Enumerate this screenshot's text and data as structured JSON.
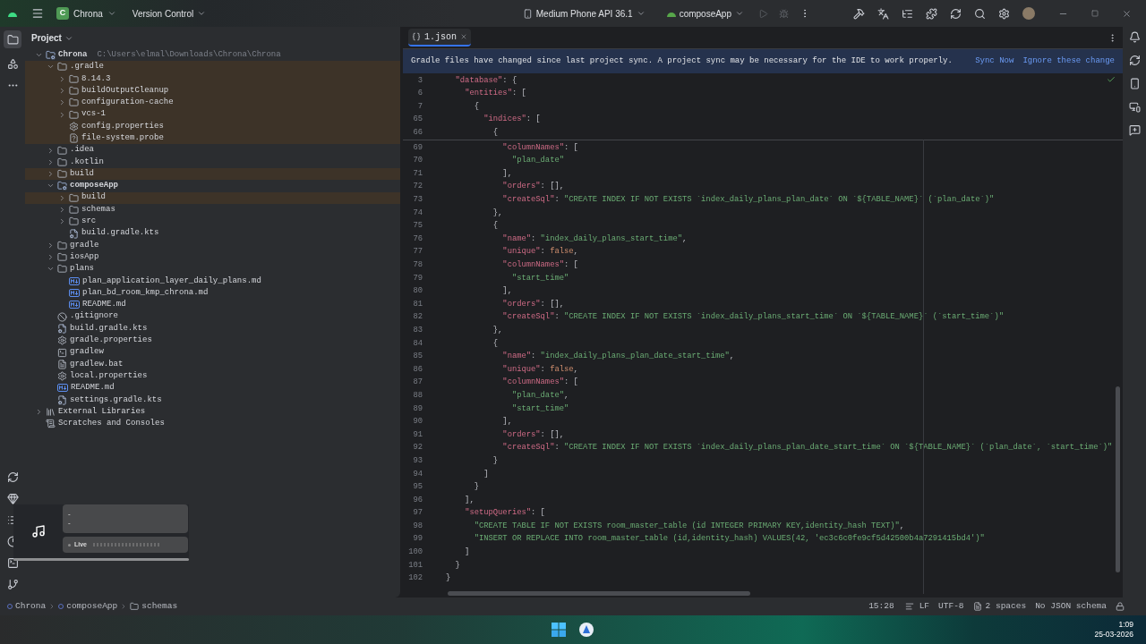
{
  "title_bar": {
    "project_badge": "C",
    "project": "Chrona",
    "vcs": "Version Control",
    "device": "Medium Phone API 36.1",
    "run_config": "composeApp"
  },
  "project_panel": {
    "title": "Project",
    "tree": [
      {
        "label": "Chrona",
        "hint": "C:\\Users\\elmal\\Downloads\\Chrona\\Chrona",
        "kind": "module",
        "expanded": true,
        "excluded": false,
        "children": [
          {
            "label": ".gradle",
            "kind": "folder",
            "expanded": true,
            "excluded": true,
            "children": [
              {
                "label": "8.14.3",
                "kind": "folder",
                "expanded": false,
                "excluded": true
              },
              {
                "label": "buildOutputCleanup",
                "kind": "folder",
                "expanded": false,
                "excluded": true
              },
              {
                "label": "configuration-cache",
                "kind": "folder",
                "expanded": false,
                "excluded": true
              },
              {
                "label": "vcs-1",
                "kind": "folder",
                "expanded": false,
                "excluded": true
              },
              {
                "label": "config.properties",
                "kind": "settings",
                "excluded": true
              },
              {
                "label": "file-system.probe",
                "kind": "unknown",
                "excluded": true
              }
            ]
          },
          {
            "label": ".idea",
            "kind": "folder",
            "expanded": false,
            "excluded": false
          },
          {
            "label": ".kotlin",
            "kind": "folder",
            "expanded": false,
            "excluded": false
          },
          {
            "label": "build",
            "kind": "folder",
            "expanded": false,
            "excluded": true
          },
          {
            "label": "composeApp",
            "kind": "module",
            "expanded": true,
            "excluded": false,
            "children": [
              {
                "label": "build",
                "kind": "folder",
                "expanded": false,
                "excluded": true
              },
              {
                "label": "schemas",
                "kind": "folder",
                "expanded": false,
                "excluded": false
              },
              {
                "label": "src",
                "kind": "folder",
                "expanded": false,
                "excluded": false
              },
              {
                "label": "build.gradle.kts",
                "kind": "gradle",
                "excluded": false
              }
            ]
          },
          {
            "label": "gradle",
            "kind": "folder",
            "expanded": false,
            "excluded": false
          },
          {
            "label": "iosApp",
            "kind": "folder",
            "expanded": false,
            "excluded": false
          },
          {
            "label": "plans",
            "kind": "folder",
            "expanded": true,
            "excluded": false,
            "children": [
              {
                "label": "plan_application_layer_daily_plans.md",
                "kind": "markdown",
                "excluded": false
              },
              {
                "label": "plan_bd_room_kmp_chrona.md",
                "kind": "markdown",
                "excluded": false
              },
              {
                "label": "README.md",
                "kind": "markdown",
                "excluded": false
              }
            ]
          },
          {
            "label": ".gitignore",
            "kind": "ignore",
            "excluded": false
          },
          {
            "label": "build.gradle.kts",
            "kind": "gradle",
            "excluded": false
          },
          {
            "label": "gradle.properties",
            "kind": "settings",
            "excluded": false
          },
          {
            "label": "gradlew",
            "kind": "terminal",
            "excluded": false
          },
          {
            "label": "gradlew.bat",
            "kind": "script",
            "excluded": false
          },
          {
            "label": "local.properties",
            "kind": "settings",
            "excluded": false
          },
          {
            "label": "README.md",
            "kind": "markdown",
            "excluded": false
          },
          {
            "label": "settings.gradle.kts",
            "kind": "gradle",
            "excluded": false
          }
        ]
      },
      {
        "label": "External Libraries",
        "kind": "library",
        "expanded": false,
        "excluded": false
      },
      {
        "label": "Scratches and Consoles",
        "kind": "scratch",
        "excluded": false
      }
    ]
  },
  "editor": {
    "tab": "1.json",
    "banner": {
      "message": "Gradle files have changed since last project sync. A project sync may be necessary for the IDE to work properly.",
      "actions": [
        "Sync Now",
        "Ignore these change"
      ]
    },
    "sticky_lines": [
      {
        "number": "3",
        "text": "  \"database\": {"
      },
      {
        "number": "6",
        "text": "    \"entities\": ["
      },
      {
        "number": "7",
        "text": "      {"
      },
      {
        "number": "65",
        "text": "        \"indices\": ["
      },
      {
        "number": "66",
        "text": "          {"
      }
    ],
    "lines": [
      {
        "number": "69",
        "text": "            \"columnNames\": ["
      },
      {
        "number": "70",
        "text": "              \"plan_date\""
      },
      {
        "number": "71",
        "text": "            ],"
      },
      {
        "number": "72",
        "text": "            \"orders\": [],"
      },
      {
        "number": "73",
        "text": "            \"createSql\": \"CREATE INDEX IF NOT EXISTS `index_daily_plans_plan_date` ON `${TABLE_NAME}` (`plan_date`)\""
      },
      {
        "number": "74",
        "text": "          },"
      },
      {
        "number": "75",
        "text": "          {"
      },
      {
        "number": "76",
        "text": "            \"name\": \"index_daily_plans_start_time\","
      },
      {
        "number": "77",
        "text": "            \"unique\": false,"
      },
      {
        "number": "78",
        "text": "            \"columnNames\": ["
      },
      {
        "number": "79",
        "text": "              \"start_time\""
      },
      {
        "number": "80",
        "text": "            ],"
      },
      {
        "number": "81",
        "text": "            \"orders\": [],"
      },
      {
        "number": "82",
        "text": "            \"createSql\": \"CREATE INDEX IF NOT EXISTS `index_daily_plans_start_time` ON `${TABLE_NAME}` (`start_time`)\""
      },
      {
        "number": "83",
        "text": "          },"
      },
      {
        "number": "84",
        "text": "          {"
      },
      {
        "number": "85",
        "text": "            \"name\": \"index_daily_plans_plan_date_start_time\","
      },
      {
        "number": "86",
        "text": "            \"unique\": false,"
      },
      {
        "number": "87",
        "text": "            \"columnNames\": ["
      },
      {
        "number": "88",
        "text": "              \"plan_date\","
      },
      {
        "number": "89",
        "text": "              \"start_time\""
      },
      {
        "number": "90",
        "text": "            ],"
      },
      {
        "number": "91",
        "text": "            \"orders\": [],"
      },
      {
        "number": "92",
        "text": "            \"createSql\": \"CREATE INDEX IF NOT EXISTS `index_daily_plans_plan_date_start_time` ON `${TABLE_NAME}` (`plan_date`, `start_time`)\""
      },
      {
        "number": "93",
        "text": "          }"
      },
      {
        "number": "94",
        "text": "        ]"
      },
      {
        "number": "95",
        "text": "      }"
      },
      {
        "number": "96",
        "text": "    ],"
      },
      {
        "number": "97",
        "text": "    \"setupQueries\": ["
      },
      {
        "number": "98",
        "text": "      \"CREATE TABLE IF NOT EXISTS room_master_table (id INTEGER PRIMARY KEY,identity_hash TEXT)\","
      },
      {
        "number": "99",
        "text": "      \"INSERT OR REPLACE INTO room_master_table (id,identity_hash) VALUES(42, 'ec3c6c0fe9cf5d42500b4a7291415bd4')\""
      },
      {
        "number": "100",
        "text": "    ]"
      },
      {
        "number": "101",
        "text": "  }"
      },
      {
        "number": "102",
        "text": "}"
      }
    ]
  },
  "media_widget": {
    "lines": [
      "-",
      "-"
    ],
    "badge": "Live",
    "level": 1
  },
  "breadcrumbs": [
    "Chrona",
    "composeApp",
    "schemas"
  ],
  "status_bar": {
    "position": "15:28",
    "line_separator": "LF",
    "encoding": "UTF-8",
    "indent": "2 spaces",
    "schema": "No JSON schema"
  },
  "taskbar": {
    "time": "1:09",
    "date": "25-03-2026"
  }
}
